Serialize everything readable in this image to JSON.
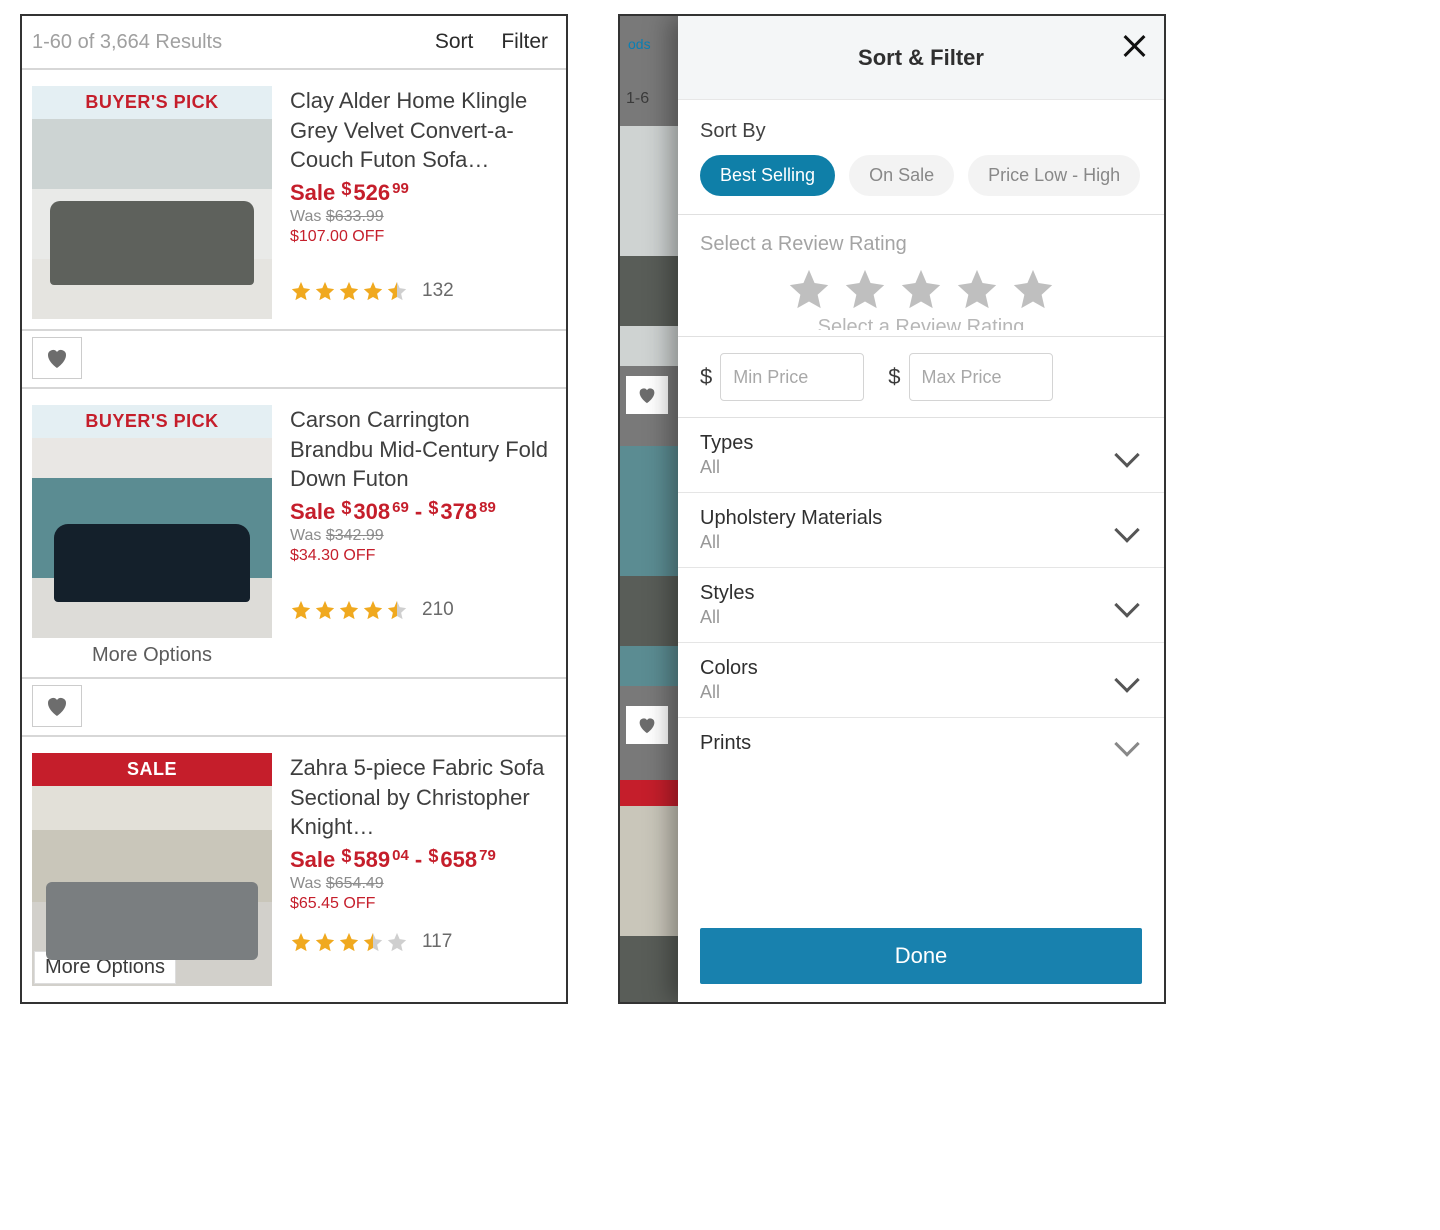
{
  "colors": {
    "accent_red": "#c51e2b",
    "accent_blue": "#1881ae",
    "star": "#f0a91f",
    "star_empty": "#cfcfcf",
    "heart": "#6d6d6d"
  },
  "left": {
    "results_text": "1-60 of 3,664 Results",
    "sort_label": "Sort",
    "filter_label": "Filter",
    "heart_icon": "heart-icon",
    "more_options_label": "More Options",
    "products": [
      {
        "badge_type": "pick",
        "badge_text": "BUYER'S PICK",
        "title": "Clay Alder Home Klingle Grey Velvet Convert-a-Couch Futon Sofa…",
        "sale_word": "Sale",
        "price_main": "526",
        "price_cents": "99",
        "was_word": "Was",
        "was_price": "$633.99",
        "off_text": "$107.00 OFF",
        "rating": 4.5,
        "reviews": "132",
        "more_options": false,
        "show_heart": true
      },
      {
        "badge_type": "pick",
        "badge_text": "BUYER'S PICK",
        "title": "Carson Carrington Brandbu Mid-Century Fold Down Futon",
        "sale_word": "Sale",
        "price_main": "308",
        "price_cents": "69",
        "price_range_sep": " - ",
        "price2_main": "378",
        "price2_cents": "89",
        "was_word": "Was",
        "was_price": "$342.99",
        "off_text": "$34.30 OFF",
        "rating": 4.5,
        "reviews": "210",
        "more_options": true,
        "show_heart": true
      },
      {
        "badge_type": "sale",
        "badge_text": "SALE",
        "title": "Zahra 5-piece Fabric Sofa Sectional by Christopher Knight…",
        "sale_word": "Sale",
        "price_main": "589",
        "price_cents": "04",
        "price_range_sep": " - ",
        "price2_main": "658",
        "price2_cents": "79",
        "was_word": "Was",
        "was_price": "$654.49",
        "off_text": "$65.45 OFF",
        "rating": 3.5,
        "reviews": "117",
        "more_options_overlay": true,
        "show_heart": false
      }
    ]
  },
  "right": {
    "bg_crumb": "ods",
    "bg_results": "1-6",
    "sheet_title": "Sort & Filter",
    "sort_by_label": "Sort By",
    "sort_pills": [
      {
        "label": "Best Selling",
        "active": true
      },
      {
        "label": "On Sale",
        "active": false
      },
      {
        "label": "Price Low - High",
        "active": false
      }
    ],
    "rating_label": "Select a Review Rating",
    "rating_cut_text": "Select a Review Rating",
    "min_price_placeholder": "Min Price",
    "max_price_placeholder": "Max Price",
    "dollar_sign": "$",
    "categories": [
      {
        "name": "Types",
        "value": "All"
      },
      {
        "name": "Upholstery Materials",
        "value": "All"
      },
      {
        "name": "Styles",
        "value": "All"
      },
      {
        "name": "Colors",
        "value": "All"
      },
      {
        "name": "Prints",
        "value": ""
      }
    ],
    "done_label": "Done"
  }
}
